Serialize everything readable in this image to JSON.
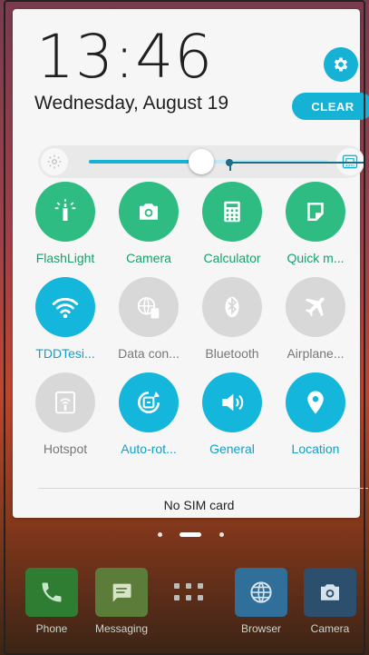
{
  "status": {
    "time": "13:46",
    "date": "Wednesday, August 19"
  },
  "header": {
    "settings_icon": "gear-icon",
    "clear_label": "CLEAR",
    "accent": "#16b2d6"
  },
  "brightness": {
    "level_percent": 47,
    "auto_label": "AUTO"
  },
  "tiles": [
    {
      "id": "flashlight",
      "label": "FlashLight",
      "icon": "flashlight-icon",
      "state": "green"
    },
    {
      "id": "camera",
      "label": "Camera",
      "icon": "camera-icon",
      "state": "green"
    },
    {
      "id": "calculator",
      "label": "Calculator",
      "icon": "calculator-icon",
      "state": "green"
    },
    {
      "id": "quick-memo",
      "label": "Quick m...",
      "icon": "note-icon",
      "state": "green"
    },
    {
      "id": "wifi",
      "label": "TDDTesi...",
      "icon": "wifi-icon",
      "state": "blue"
    },
    {
      "id": "data",
      "label": "Data con...",
      "icon": "data-connection-icon",
      "state": "gray"
    },
    {
      "id": "bluetooth",
      "label": "Bluetooth",
      "icon": "bluetooth-icon",
      "state": "gray"
    },
    {
      "id": "airplane",
      "label": "Airplane...",
      "icon": "airplane-icon",
      "state": "gray"
    },
    {
      "id": "hotspot",
      "label": "Hotspot",
      "icon": "hotspot-icon",
      "state": "gray"
    },
    {
      "id": "autorotate",
      "label": "Auto-rot...",
      "icon": "rotate-icon",
      "state": "blue"
    },
    {
      "id": "sound",
      "label": "General",
      "icon": "volume-icon",
      "state": "blue"
    },
    {
      "id": "location",
      "label": "Location",
      "icon": "location-pin-icon",
      "state": "blue"
    }
  ],
  "footer": {
    "sim_status": "No SIM card"
  },
  "dock": [
    {
      "label": "Phone",
      "icon": "phone-icon",
      "color": "#2e7d32"
    },
    {
      "label": "Messaging",
      "icon": "message-icon",
      "color": "#5c7d3a"
    },
    {
      "label": "Browser",
      "icon": "globe-icon",
      "color": "#2f6f9a"
    },
    {
      "label": "Camera",
      "icon": "camera-icon",
      "color": "#2d4f6e"
    }
  ]
}
